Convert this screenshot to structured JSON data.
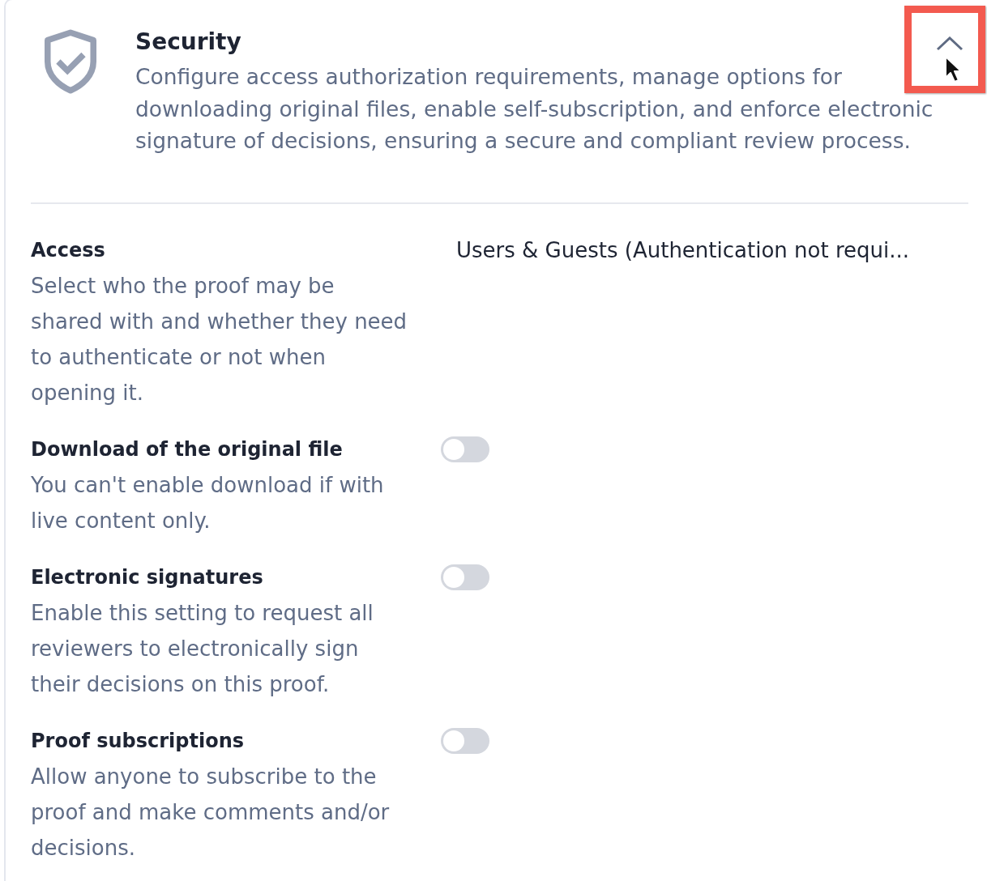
{
  "section": {
    "title": "Security",
    "description": "Configure access authorization requirements, manage options for downloading original files, enable self-subscription, and enforce electronic signature of decisions, ensuring a secure and compliant review process.",
    "expanded": true
  },
  "settings": [
    {
      "kind": "select",
      "label": "Access",
      "description": "Select who the proof may be shared with and whether they need to authenticate or not when opening it.",
      "value": "Users & Guests (Authentication not requi..."
    },
    {
      "kind": "toggle",
      "label": "Download of the original file",
      "description": "You can't enable download if with live content only.",
      "on": false
    },
    {
      "kind": "toggle",
      "label": "Electronic signatures",
      "description": "Enable this setting to request all reviewers to electronically sign their decisions on this proof.",
      "on": false
    },
    {
      "kind": "toggle",
      "label": "Proof subscriptions",
      "description": "Allow anyone to subscribe to the proof and make comments and/or decisions.",
      "on": false
    }
  ]
}
